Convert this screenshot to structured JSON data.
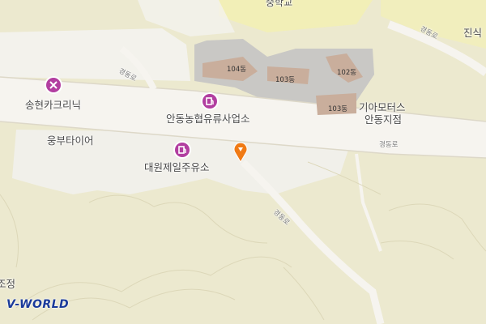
{
  "map": {
    "provider_logo": "V-WORLD",
    "pois": [
      {
        "name": "송현카크리닉",
        "icon": "car-repair-icon"
      },
      {
        "name": "안동농협유류사업소",
        "icon": "gas-station-icon"
      },
      {
        "name": "대원제일주유소",
        "icon": "gas-station-icon"
      }
    ],
    "labels": {
      "tire_shop": "웅부타이어",
      "kia_line1": "기아모터스",
      "kia_line2": "안동지점",
      "school_top": "중학교",
      "top_right": "진식",
      "left_edge": "조정"
    },
    "buildings": [
      "104동",
      "103동",
      "102동",
      "103동"
    ],
    "roads": [
      "경동로",
      "경동로",
      "경동로",
      "경동로"
    ],
    "colors": {
      "background": "#ece9cf",
      "road": "#f4f2ef",
      "complex": "#c8c8c6",
      "building": "#c8ad9d",
      "poi": "#b23ea0",
      "marker": "#f07a14"
    }
  }
}
